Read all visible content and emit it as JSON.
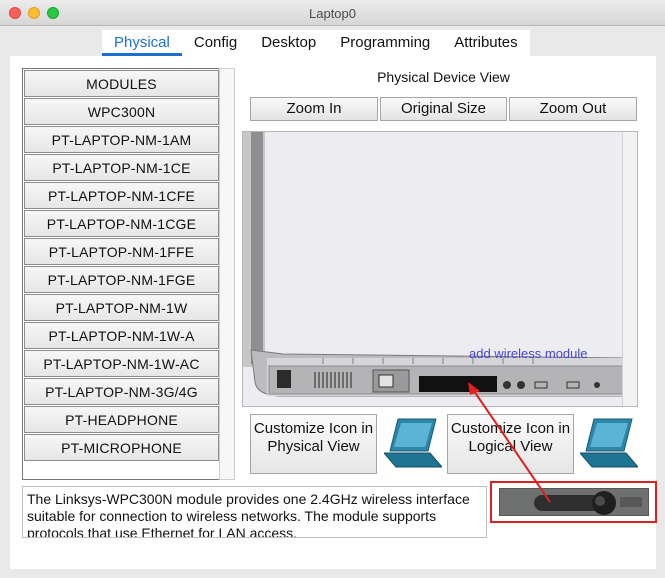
{
  "window": {
    "title": "Laptop0"
  },
  "tabs": [
    {
      "label": "Physical",
      "active": true
    },
    {
      "label": "Config"
    },
    {
      "label": "Desktop"
    },
    {
      "label": "Programming"
    },
    {
      "label": "Attributes"
    }
  ],
  "modules": {
    "items": [
      "MODULES",
      "WPC300N",
      "PT-LAPTOP-NM-1AM",
      "PT-LAPTOP-NM-1CE",
      "PT-LAPTOP-NM-1CFE",
      "PT-LAPTOP-NM-1CGE",
      "PT-LAPTOP-NM-1FFE",
      "PT-LAPTOP-NM-1FGE",
      "PT-LAPTOP-NM-1W",
      "PT-LAPTOP-NM-1W-A",
      "PT-LAPTOP-NM-1W-AC",
      "PT-LAPTOP-NM-3G/4G",
      "PT-HEADPHONE",
      "PT-MICROPHONE"
    ]
  },
  "device_view": {
    "title": "Physical Device View",
    "zoom_in": "Zoom In",
    "original_size": "Original Size",
    "zoom_out": "Zoom Out",
    "annotation": "add wireless module"
  },
  "customize": {
    "physical_label": "Customize Icon in Physical View",
    "logical_label": "Customize Icon in Logical View"
  },
  "description": "The Linksys-WPC300N module provides one 2.4GHz wireless interface suitable for connection to wireless networks. The module supports protocols that use Ethernet for LAN access.",
  "colors": {
    "accent_tab": "#1b6fcf",
    "annotation_text": "#4545d6",
    "highlight_box": "#e02020"
  }
}
